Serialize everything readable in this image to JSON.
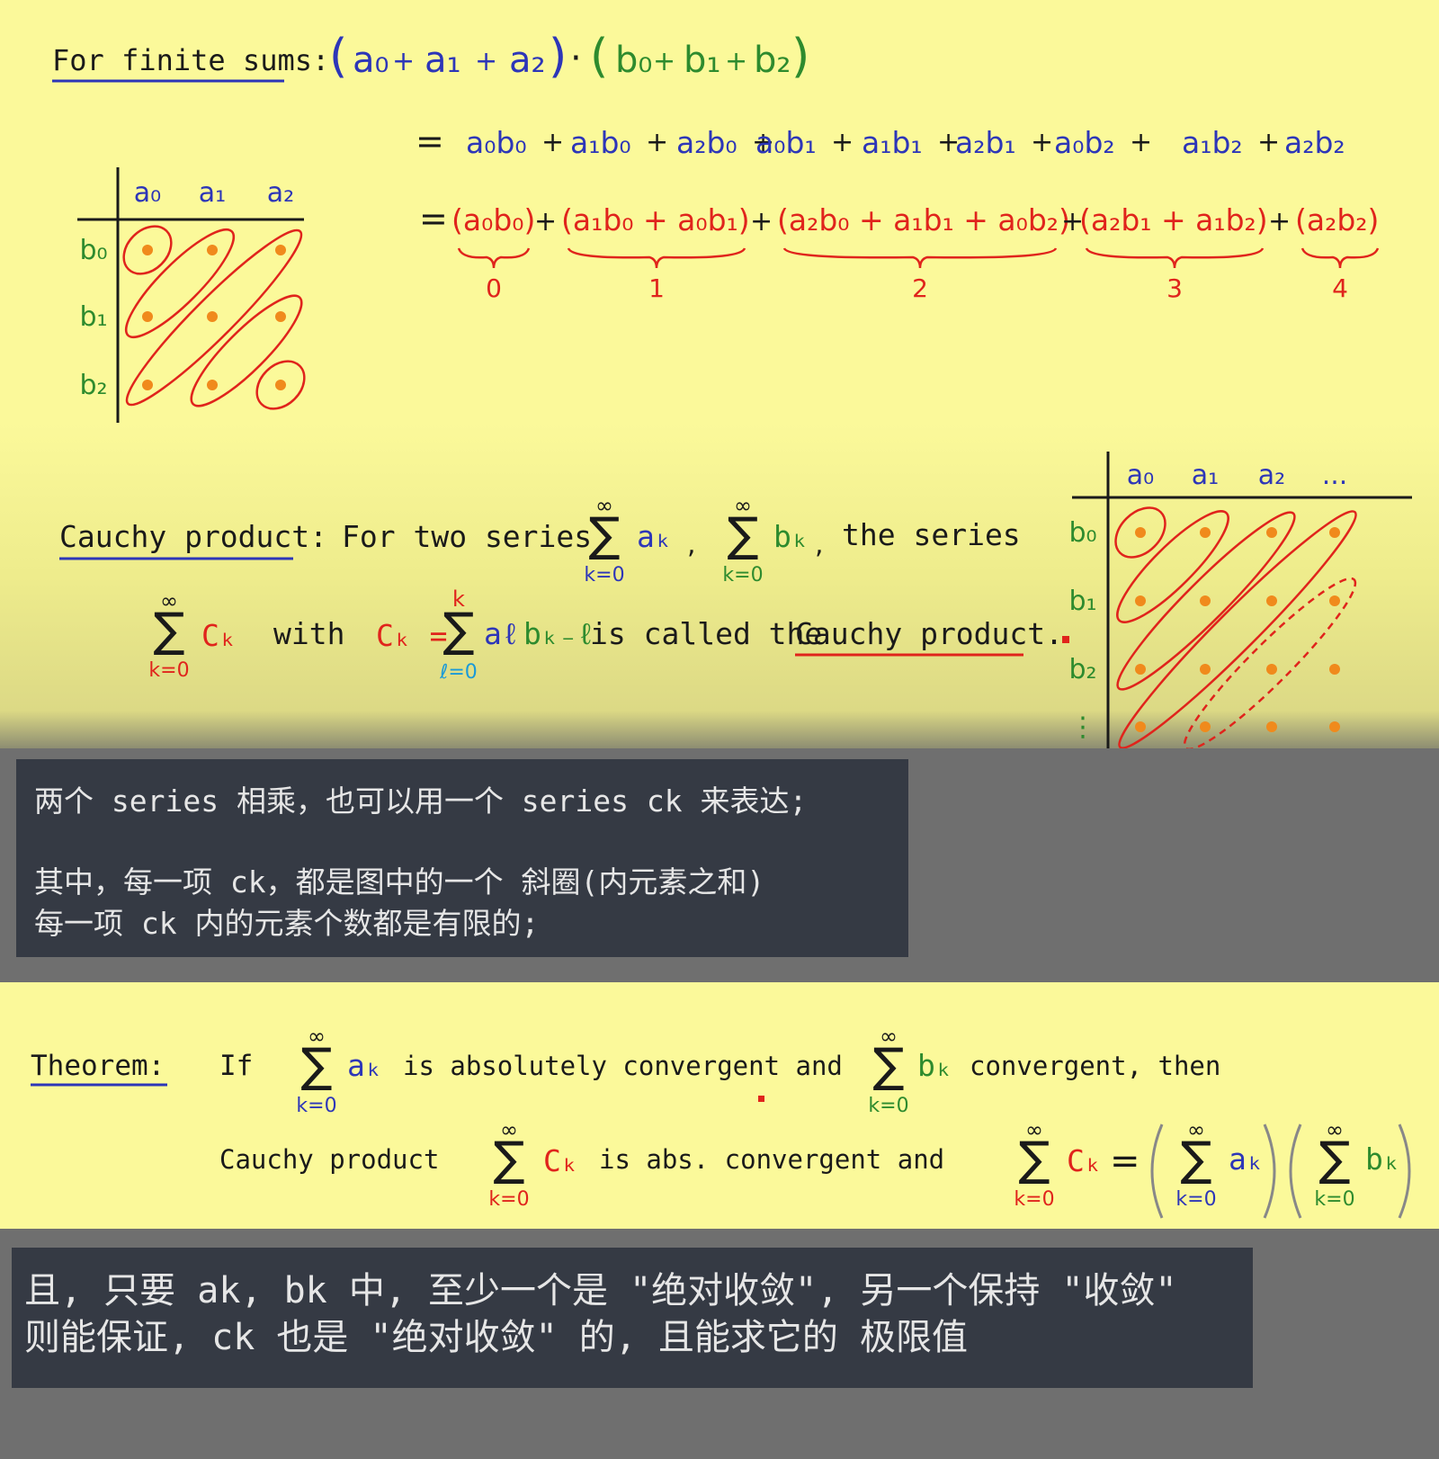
{
  "finite": {
    "label": "For finite sums:",
    "product": {
      "lp1": "(",
      "a0": "a₀",
      "plus1": "+",
      "a1": "a₁",
      "plus2": "+",
      "a2": "a₂",
      "rp1": ")",
      "dot": "·",
      "lp2": "(",
      "b0": "b₀",
      "plus3": "+",
      "b1": "b₁",
      "plus4": "+",
      "b2": "b₂",
      "rp2": ")"
    },
    "expanded": {
      "eq": "=",
      "terms": [
        "a₀b₀",
        "a₁b₀",
        "a₂b₀",
        "a₀b₁",
        "a₁b₁",
        "a₂b₁",
        "a₀b₂",
        "a₁b₂",
        "a₂b₂"
      ],
      "plus": "+"
    },
    "grouped": {
      "eq": "=",
      "groups": [
        {
          "text": "(a₀b₀)",
          "label": "0"
        },
        {
          "text": "(a₁b₀ + a₀b₁)",
          "label": "1"
        },
        {
          "text": "(a₂b₀ + a₁b₁ + a₀b₂)",
          "label": "2"
        },
        {
          "text": "(a₂b₁ + a₁b₂)",
          "label": "3"
        },
        {
          "text": "(a₂b₂)",
          "label": "4"
        }
      ],
      "plus": "+"
    },
    "grid": {
      "cols": [
        "a₀",
        "a₁",
        "a₂"
      ],
      "rows": [
        "b₀",
        "b₁",
        "b₂"
      ]
    }
  },
  "cauchy": {
    "label": "Cauchy product:",
    "intro": "For two series",
    "sum_a": {
      "top": "∞",
      "sigma": "∑",
      "bottom": "k=0",
      "term": "aₖ"
    },
    "comma": ",",
    "sum_b": {
      "top": "∞",
      "sigma": "∑",
      "bottom": "k=0",
      "term": "bₖ"
    },
    "the_series": "the series",
    "sum_c": {
      "top": "∞",
      "sigma": "∑",
      "bottom": "k=0",
      "term": "Cₖ"
    },
    "with": "with",
    "ck_def": {
      "lhs": "Cₖ =",
      "top": "k",
      "sigma": "∑",
      "bottom": "ℓ=0",
      "a_term": "aℓ",
      "b_term": "bₖ₋ℓ"
    },
    "called": "is called the",
    "term_name": "Cauchy product.",
    "grid": {
      "cols": [
        "a₀",
        "a₁",
        "a₂",
        "..."
      ],
      "rows": [
        "b₀",
        "b₁",
        "b₂",
        "⋮"
      ]
    }
  },
  "note1": {
    "line1": "两个 series 相乘，也可以用一个 series ck 来表达;",
    "line2": "其中，每一项 ck，都是图中的一个 斜圈(内元素之和)",
    "line3": "每一项 ck 内的元素个数都是有限的;"
  },
  "theorem": {
    "label": "Theorem:",
    "if": "If",
    "sum_a": {
      "top": "∞",
      "sigma": "∑",
      "bottom": "k=0",
      "term": "aₖ"
    },
    "abs": "is absolutely convergent and",
    "sum_b": {
      "top": "∞",
      "sigma": "∑",
      "bottom": "k=0",
      "term": "bₖ"
    },
    "conv": "convergent, then",
    "cp": "Cauchy product",
    "sum_c": {
      "top": "∞",
      "sigma": "∑",
      "bottom": "k=0",
      "term": "Cₖ"
    },
    "abs2": "is abs. convergent and",
    "eq_lhs": {
      "top": "∞",
      "sigma": "∑",
      "bottom": "k=0",
      "term": "Cₖ"
    },
    "eq": "=",
    "eq_a": {
      "top": "∞",
      "sigma": "∑",
      "bottom": "k=0",
      "term": "aₖ"
    },
    "eq_b": {
      "top": "∞",
      "sigma": "∑",
      "bottom": "k=0",
      "term": "bₖ"
    }
  },
  "note2": {
    "line1": "且, 只要 ak, bk 中, 至少一个是 \"绝对收敛\", 另一个保持 \"收敛\"",
    "line2": "则能保证, ck 也是 \"绝对收敛\" 的, 且能求它的 极限值"
  },
  "colors": {
    "blue": "#2d36b8",
    "green": "#2e8b2e",
    "red": "#e0241c",
    "orange": "#f08a1c",
    "dark": "#1a1a1a",
    "bg": "#fbf99a",
    "note_bg": "#353a44"
  }
}
